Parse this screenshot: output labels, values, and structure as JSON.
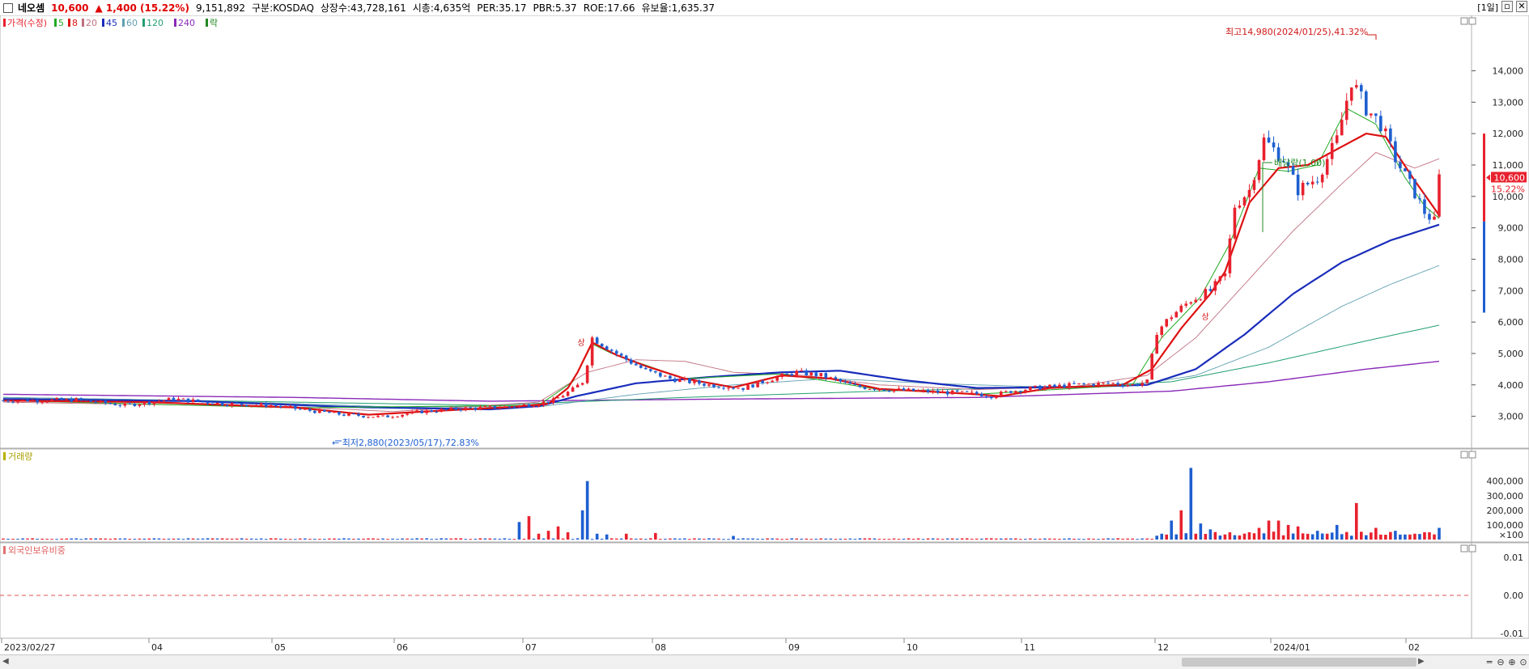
{
  "header": {
    "stock_name": "네오셈",
    "price": "10,600",
    "change": "▲ 1,400 (15.22%)",
    "volume": "9,151,892",
    "market": "구분:KOSDAQ",
    "shares": "상장수:43,728,161",
    "market_cap": "시총:4,635억",
    "per": "PER:35.17",
    "pbr": "PBR:5.37",
    "roe": "ROE:17.66",
    "float": "유보율:1,635.37",
    "period": "[1일]"
  },
  "colors": {
    "up": "#e8212e",
    "down": "#1e5fd0",
    "ma5": "#22aa22",
    "ma8": "#dd1111",
    "ma20": "#c07080",
    "ma45": "#1a2dbb",
    "ma60": "#60a0b0",
    "ma120": "#22a070",
    "ma240": "#8a2ab8"
  },
  "chart_data": [
    {
      "type": "candlestick",
      "title": "가격(수정)",
      "legend": [
        {
          "label": "가격(수정)",
          "color": "#e8212e"
        },
        {
          "label": "5",
          "color": "#22aa22"
        },
        {
          "label": "8",
          "color": "#dd1111"
        },
        {
          "label": "20",
          "color": "#c07080"
        },
        {
          "label": "45",
          "color": "#1a2dbb"
        },
        {
          "label": "60",
          "color": "#60a0b0"
        },
        {
          "label": "120",
          "color": "#22a070"
        },
        {
          "label": "240",
          "color": "#8a2ab8"
        },
        {
          "label": "락",
          "color": "#228822"
        }
      ],
      "ylim": [
        2500,
        15300
      ],
      "yticks": [
        "3,000",
        "4,000",
        "5,000",
        "6,000",
        "7,000",
        "8,000",
        "9,000",
        "10,000",
        "11,000",
        "12,000",
        "13,000",
        "14,000"
      ],
      "ytick_values": [
        3000,
        4000,
        5000,
        6000,
        7000,
        8000,
        9000,
        10000,
        11000,
        12000,
        13000,
        14000
      ],
      "current_price_label": "10,600",
      "current_change_label": "15.22%",
      "annotations": {
        "high": "최고14,980(2024/01/25),41.32%",
        "low": "최저2,880(2023/05/17),72.83%",
        "dividend": "배당락(1.00)",
        "up_mark": "상"
      },
      "x_labels": [
        "2023/02/27",
        "04",
        "05",
        "06",
        "07",
        "08",
        "09",
        "10",
        "11",
        "12",
        "2024/01",
        "02"
      ],
      "anchors": [
        [
          0,
          3500
        ],
        [
          15,
          3520
        ],
        [
          25,
          3350
        ],
        [
          35,
          3550
        ],
        [
          45,
          3400
        ],
        [
          55,
          3350
        ],
        [
          62,
          3200
        ],
        [
          70,
          3050
        ],
        [
          78,
          2980
        ],
        [
          86,
          3150
        ],
        [
          95,
          3250
        ],
        [
          103,
          3300
        ],
        [
          109,
          3380
        ],
        [
          113,
          3500
        ],
        [
          117,
          3850
        ],
        [
          119,
          4100
        ],
        [
          120,
          4700
        ],
        [
          121,
          5500
        ],
        [
          124,
          5200
        ],
        [
          127,
          4900
        ],
        [
          132,
          4450
        ],
        [
          137,
          4200
        ],
        [
          145,
          4000
        ],
        [
          152,
          3900
        ],
        [
          158,
          4200
        ],
        [
          163,
          4400
        ],
        [
          168,
          4300
        ],
        [
          175,
          3950
        ],
        [
          182,
          3850
        ],
        [
          188,
          3800
        ],
        [
          195,
          3750
        ],
        [
          200,
          3720
        ],
        [
          203,
          3650
        ],
        [
          207,
          3800
        ],
        [
          212,
          3900
        ],
        [
          220,
          4000
        ],
        [
          228,
          4050
        ],
        [
          232,
          4000
        ],
        [
          235,
          4100
        ],
        [
          237,
          5700
        ],
        [
          240,
          6200
        ],
        [
          244,
          6700
        ],
        [
          248,
          7000
        ],
        [
          251,
          7500
        ],
        [
          253,
          9700
        ],
        [
          256,
          10200
        ],
        [
          259,
          11800
        ],
        [
          263,
          11200
        ],
        [
          266,
          10200
        ],
        [
          270,
          10600
        ],
        [
          274,
          11800
        ],
        [
          277,
          13700
        ],
        [
          280,
          12800
        ],
        [
          283,
          12300
        ],
        [
          286,
          11200
        ],
        [
          290,
          10100
        ],
        [
          292,
          9500
        ],
        [
          294,
          9200
        ],
        [
          295,
          10600
        ]
      ],
      "moving_averages": {
        "ma8": [
          [
            0,
            3500
          ],
          [
            30,
            3450
          ],
          [
            60,
            3280
          ],
          [
            75,
            3050
          ],
          [
            90,
            3180
          ],
          [
            105,
            3300
          ],
          [
            112,
            3400
          ],
          [
            116,
            3900
          ],
          [
            118,
            4400
          ],
          [
            121,
            5350
          ],
          [
            126,
            4950
          ],
          [
            132,
            4600
          ],
          [
            140,
            4200
          ],
          [
            150,
            3920
          ],
          [
            160,
            4300
          ],
          [
            170,
            4200
          ],
          [
            180,
            3870
          ],
          [
            190,
            3790
          ],
          [
            200,
            3700
          ],
          [
            205,
            3640
          ],
          [
            215,
            3900
          ],
          [
            230,
            4000
          ],
          [
            236,
            4500
          ],
          [
            242,
            5800
          ],
          [
            248,
            6900
          ],
          [
            251,
            7600
          ],
          [
            256,
            9800
          ],
          [
            262,
            10900
          ],
          [
            268,
            11000
          ],
          [
            274,
            11500
          ],
          [
            280,
            12000
          ],
          [
            284,
            11900
          ],
          [
            290,
            10500
          ],
          [
            295,
            9400
          ]
        ],
        "ma5": [
          [
            0,
            3500
          ],
          [
            60,
            3270
          ],
          [
            110,
            3350
          ],
          [
            117,
            4100
          ],
          [
            121,
            5300
          ],
          [
            125,
            5000
          ],
          [
            140,
            4200
          ],
          [
            160,
            4350
          ],
          [
            180,
            3850
          ],
          [
            200,
            3700
          ],
          [
            232,
            4000
          ],
          [
            238,
            5500
          ],
          [
            246,
            6800
          ],
          [
            252,
            8500
          ],
          [
            258,
            10900
          ],
          [
            264,
            10800
          ],
          [
            270,
            11000
          ],
          [
            276,
            12800
          ],
          [
            282,
            12300
          ],
          [
            288,
            10600
          ],
          [
            292,
            9700
          ],
          [
            295,
            9300
          ]
        ],
        "ma20": [
          [
            0,
            3450
          ],
          [
            60,
            3300
          ],
          [
            80,
            3150
          ],
          [
            110,
            3450
          ],
          [
            120,
            4400
          ],
          [
            130,
            4800
          ],
          [
            140,
            4750
          ],
          [
            150,
            4400
          ],
          [
            165,
            4300
          ],
          [
            180,
            4000
          ],
          [
            200,
            3850
          ],
          [
            220,
            3950
          ],
          [
            235,
            4300
          ],
          [
            245,
            5500
          ],
          [
            255,
            7200
          ],
          [
            265,
            8900
          ],
          [
            275,
            10400
          ],
          [
            282,
            11400
          ],
          [
            290,
            10900
          ],
          [
            295,
            11200
          ]
        ],
        "ma45": [
          [
            0,
            3550
          ],
          [
            40,
            3480
          ],
          [
            70,
            3300
          ],
          [
            100,
            3220
          ],
          [
            110,
            3320
          ],
          [
            118,
            3650
          ],
          [
            130,
            4050
          ],
          [
            145,
            4250
          ],
          [
            160,
            4400
          ],
          [
            172,
            4450
          ],
          [
            185,
            4150
          ],
          [
            200,
            3900
          ],
          [
            220,
            3930
          ],
          [
            235,
            4000
          ],
          [
            245,
            4500
          ],
          [
            255,
            5600
          ],
          [
            265,
            6900
          ],
          [
            275,
            7900
          ],
          [
            285,
            8600
          ],
          [
            295,
            9100
          ]
        ],
        "ma60": [
          [
            0,
            3600
          ],
          [
            40,
            3500
          ],
          [
            80,
            3300
          ],
          [
            110,
            3300
          ],
          [
            130,
            3700
          ],
          [
            150,
            4000
          ],
          [
            170,
            4200
          ],
          [
            190,
            4050
          ],
          [
            210,
            3950
          ],
          [
            230,
            3950
          ],
          [
            245,
            4300
          ],
          [
            260,
            5200
          ],
          [
            275,
            6500
          ],
          [
            285,
            7200
          ],
          [
            295,
            7800
          ]
        ],
        "ma120": [
          [
            0,
            3600
          ],
          [
            60,
            3450
          ],
          [
            100,
            3350
          ],
          [
            140,
            3600
          ],
          [
            180,
            3800
          ],
          [
            220,
            3950
          ],
          [
            240,
            4100
          ],
          [
            260,
            4700
          ],
          [
            280,
            5400
          ],
          [
            295,
            5900
          ]
        ],
        "ma240": [
          [
            0,
            3700
          ],
          [
            60,
            3600
          ],
          [
            100,
            3480
          ],
          [
            150,
            3550
          ],
          [
            200,
            3600
          ],
          [
            240,
            3800
          ],
          [
            260,
            4100
          ],
          [
            280,
            4500
          ],
          [
            295,
            4750
          ]
        ]
      }
    },
    {
      "type": "bar",
      "title": "거래량",
      "ylim": [
        0,
        520000
      ],
      "yticks": [
        "400,000",
        "300,000",
        "200,000",
        "100,000",
        "×100"
      ],
      "ytick_values": [
        400000,
        300000,
        200000,
        100000,
        0
      ],
      "spikes": [
        [
          106,
          120000
        ],
        [
          108,
          160000
        ],
        [
          110,
          40000
        ],
        [
          112,
          60000
        ],
        [
          114,
          90000
        ],
        [
          116,
          50000
        ],
        [
          119,
          200000
        ],
        [
          120,
          400000
        ],
        [
          122,
          40000
        ],
        [
          124,
          35000
        ],
        [
          128,
          40000
        ],
        [
          134,
          45000
        ],
        [
          150,
          25000
        ],
        [
          240,
          130000
        ],
        [
          242,
          200000
        ],
        [
          244,
          490000
        ],
        [
          246,
          110000
        ],
        [
          248,
          70000
        ],
        [
          252,
          50000
        ],
        [
          258,
          80000
        ],
        [
          260,
          130000
        ],
        [
          262,
          130000
        ],
        [
          264,
          100000
        ],
        [
          266,
          90000
        ],
        [
          270,
          60000
        ],
        [
          272,
          40000
        ],
        [
          274,
          100000
        ],
        [
          278,
          250000
        ],
        [
          282,
          80000
        ],
        [
          286,
          60000
        ],
        [
          290,
          40000
        ],
        [
          295,
          80000
        ]
      ]
    },
    {
      "type": "line",
      "title": "외국인보유비중",
      "ylim": [
        -0.01,
        0.01
      ],
      "yticks": [
        "0.01",
        "0.00",
        "-0.01"
      ],
      "ytick_values": [
        0.01,
        0,
        -0.01
      ],
      "values": [
        0.0
      ]
    }
  ]
}
